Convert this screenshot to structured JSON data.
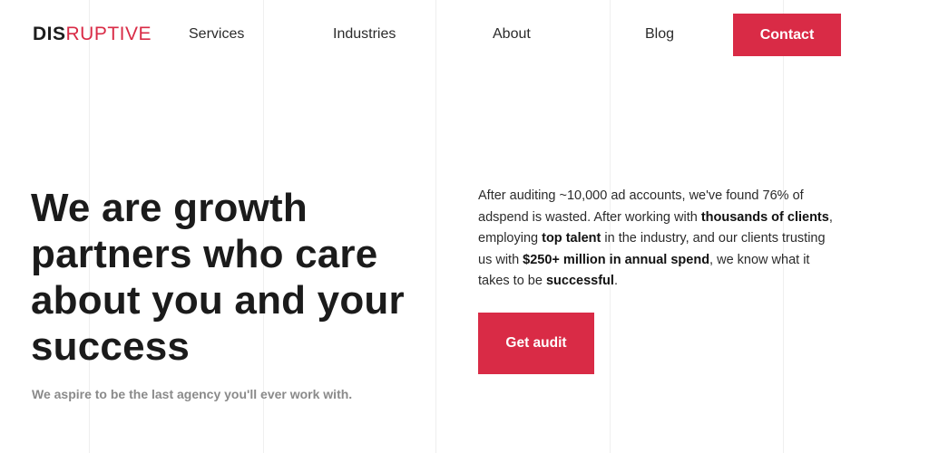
{
  "header": {
    "logo": {
      "part1": "DIS",
      "part2": "RUPTIVE"
    },
    "nav": [
      {
        "label": "Services"
      },
      {
        "label": "Industries"
      },
      {
        "label": "About"
      },
      {
        "label": "Blog"
      }
    ],
    "contact_label": "Contact"
  },
  "hero": {
    "title": "We are growth partners who care about you and your success",
    "subtitle": "We aspire to be the last agency you'll ever work with.",
    "body": {
      "t1": "After auditing ~10,000 ad accounts, we've found 76% of adspend is wasted. After working with ",
      "b1": "thousands of clients",
      "t2": ", employing ",
      "b2": "top talent",
      "t3": " in the industry, and our clients trusting us with ",
      "b3": "$250+ million in annual spend",
      "t4": ", we know what it takes to be ",
      "b4": "successful",
      "t5": "."
    },
    "cta_label": "Get audit"
  },
  "colors": {
    "brand_red": "#d92b46",
    "heading": "#1b1b1b",
    "muted": "#8a8a8a",
    "background": "#ffffff"
  }
}
